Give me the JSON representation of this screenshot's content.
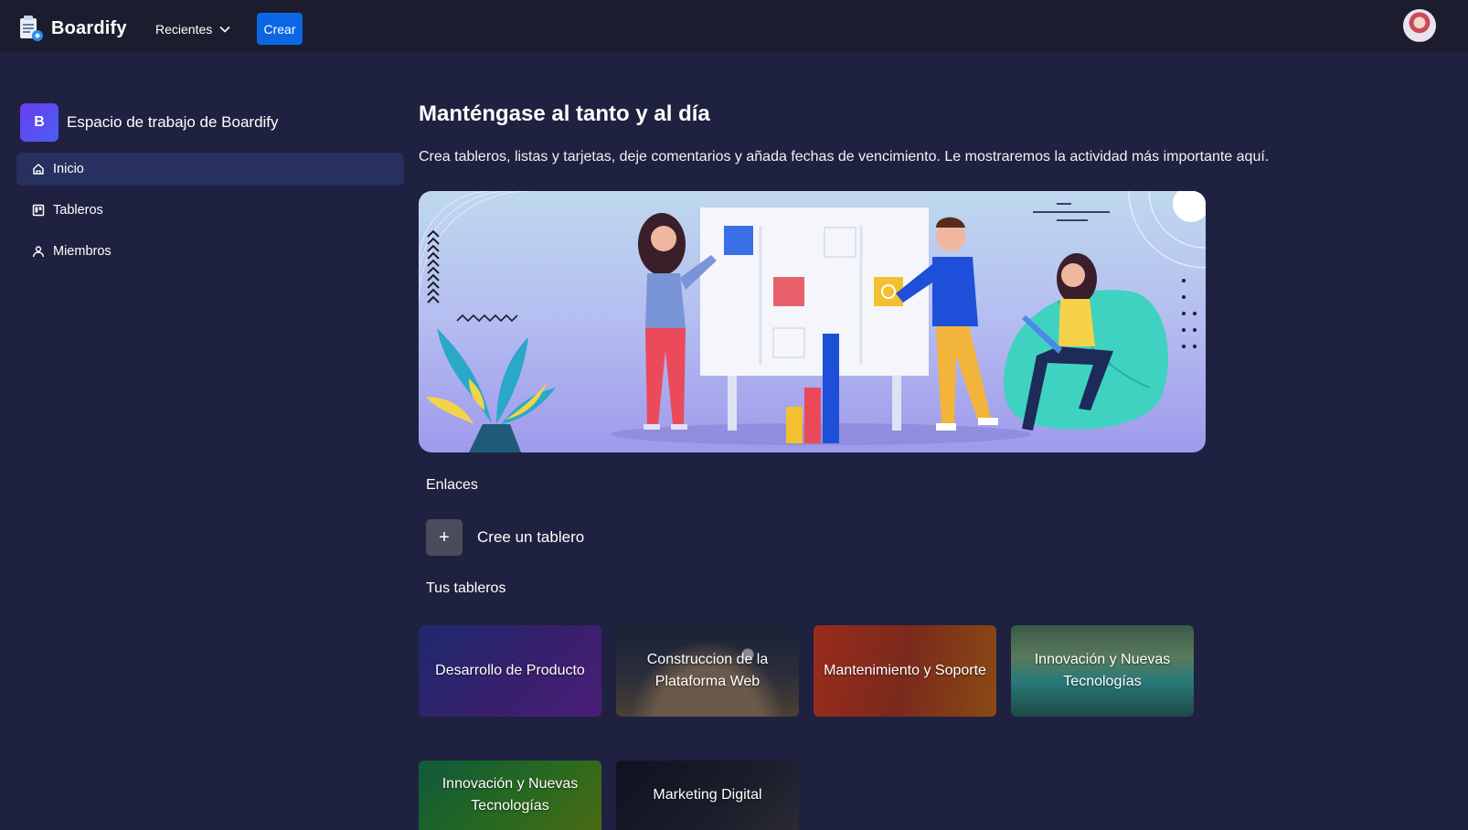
{
  "app": {
    "name": "Boardify"
  },
  "topbar": {
    "recent_label": "Recientes",
    "create_label": "Crear"
  },
  "sidebar": {
    "workspace_initial": "B",
    "workspace_name": "Espacio de trabajo de Boardify",
    "items": [
      {
        "label": "Inicio",
        "icon": "home-icon",
        "active": true
      },
      {
        "label": "Tableros",
        "icon": "board-icon",
        "active": false
      },
      {
        "label": "Miembros",
        "icon": "members-icon",
        "active": false
      }
    ]
  },
  "main": {
    "title": "Manténgase al tanto y al día",
    "subtitle": "Crea tableros, listas y tarjetas, deje comentarios y añada fechas de vencimiento. Le mostraremos la actividad más importante aquí.",
    "links_heading": "Enlaces",
    "create_board_label": "Cree un tablero",
    "boards_heading": "Tus tableros",
    "boards": [
      {
        "name": "Desarrollo de Producto"
      },
      {
        "name": "Construccion de la Plataforma Web"
      },
      {
        "name": "Mantenimiento y Soporte"
      },
      {
        "name": "Innovación y Nuevas Tecnologías"
      },
      {
        "name": "Innovación y Nuevas Tecnologías"
      },
      {
        "name": "Marketing Digital"
      }
    ]
  },
  "colors": {
    "background": "#1f2140",
    "topbar": "#1b1d2e",
    "accent": "#0c66e4",
    "active_nav": "#27305e"
  }
}
